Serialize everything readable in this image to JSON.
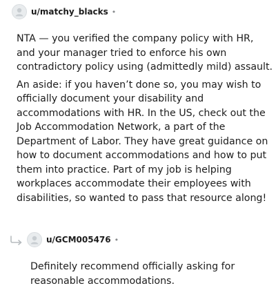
{
  "comments": [
    {
      "username": "u/matchy_blacks",
      "separator": "•",
      "paragraphs": [
        "NTA — you verified the company policy with HR, and your manager tried to enforce his own contradictory policy using (admittedly mild) assault.",
        "An aside: if you haven’t done so, you may wish to officially document your disability and accommodations with HR. In the US, check out the Job Accommodation Network, a part of the Department of Labor. They have great guidance on how to document accommodations and how to put them into practice. Part of my job is helping workplaces accommodate their employees with disabilities, so wanted to pass that resource along!"
      ]
    },
    {
      "username": "u/GCM005476",
      "separator": "•",
      "paragraphs": [
        "Definitely recommend officially asking for reasonable accommodations."
      ]
    }
  ],
  "icons": {
    "avatar": "default-avatar-icon",
    "reply": "reply-arrow-icon"
  }
}
